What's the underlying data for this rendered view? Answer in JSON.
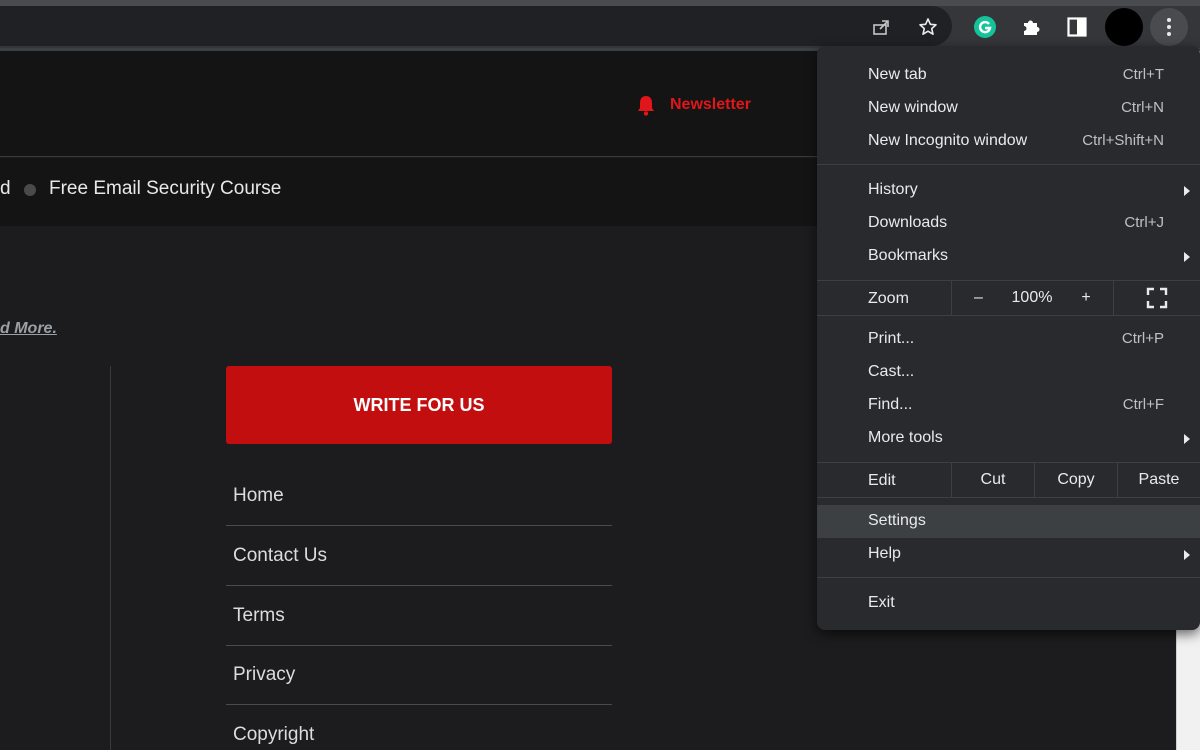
{
  "page": {
    "newsletter_label": "Newsletter",
    "nav_partial": "d",
    "nav_item": "Free Email Security Course",
    "read_more": "d More.",
    "cta_label": "WRITE FOR US",
    "side_links": [
      "Home",
      "Contact Us",
      "Terms",
      "Privacy",
      "Copyright"
    ]
  },
  "chrome_menu": {
    "items": {
      "new_tab": {
        "label": "New tab",
        "shortcut": "Ctrl+T"
      },
      "new_window": {
        "label": "New window",
        "shortcut": "Ctrl+N"
      },
      "new_incognito": {
        "label": "New Incognito window",
        "shortcut": "Ctrl+Shift+N"
      },
      "history": {
        "label": "History"
      },
      "downloads": {
        "label": "Downloads",
        "shortcut": "Ctrl+J"
      },
      "bookmarks": {
        "label": "Bookmarks"
      },
      "print": {
        "label": "Print...",
        "shortcut": "Ctrl+P"
      },
      "cast": {
        "label": "Cast..."
      },
      "find": {
        "label": "Find...",
        "shortcut": "Ctrl+F"
      },
      "more_tools": {
        "label": "More tools"
      },
      "settings": {
        "label": "Settings"
      },
      "help": {
        "label": "Help"
      },
      "exit": {
        "label": "Exit"
      }
    },
    "zoom": {
      "label": "Zoom",
      "minus": "–",
      "value": "100%",
      "plus": "+"
    },
    "edit": {
      "label": "Edit",
      "cut": "Cut",
      "copy": "Copy",
      "paste": "Paste"
    }
  },
  "colors": {
    "accent_red": "#c20e0e",
    "newsletter_red": "#e0161a",
    "grammarly_green": "#15c39a"
  }
}
